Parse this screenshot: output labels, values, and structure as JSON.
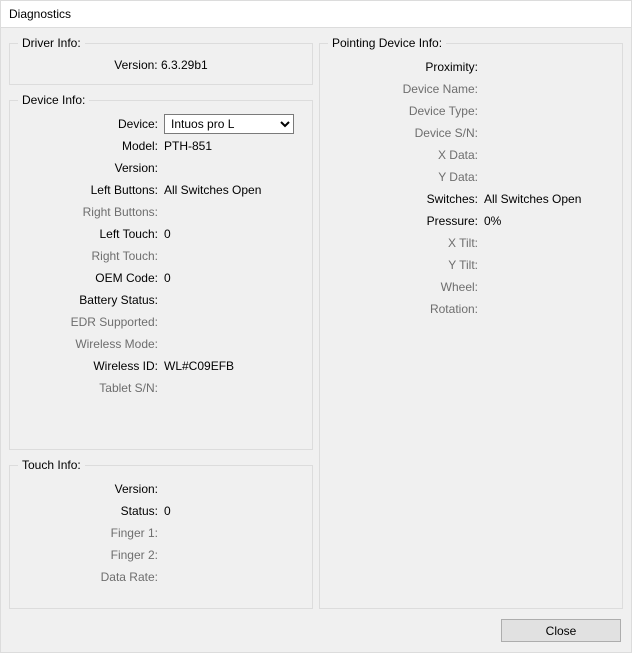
{
  "window_title": "Diagnostics",
  "close_button": "Close",
  "driver": {
    "legend": "Driver Info:",
    "version_label": "Version:",
    "version_value": "6.3.29b1"
  },
  "device": {
    "legend": "Device Info:",
    "device_label": "Device:",
    "device_value": "Intuos pro L",
    "model_label": "Model:",
    "model_value": "PTH-851",
    "version_label": "Version:",
    "version_value": "",
    "left_buttons_label": "Left Buttons:",
    "left_buttons_value": "All Switches Open",
    "right_buttons_label": "Right Buttons:",
    "right_buttons_value": "",
    "left_touch_label": "Left Touch:",
    "left_touch_value": "0",
    "right_touch_label": "Right Touch:",
    "right_touch_value": "",
    "oem_code_label": "OEM Code:",
    "oem_code_value": "0",
    "battery_status_label": "Battery Status:",
    "battery_status_value": "",
    "edr_supported_label": "EDR Supported:",
    "edr_supported_value": "",
    "wireless_mode_label": "Wireless Mode:",
    "wireless_mode_value": "",
    "wireless_id_label": "Wireless ID:",
    "wireless_id_value": "WL#C09EFB",
    "tablet_sn_label": "Tablet S/N:",
    "tablet_sn_value": ""
  },
  "touch": {
    "legend": "Touch Info:",
    "version_label": "Version:",
    "version_value": "",
    "status_label": "Status:",
    "status_value": "0",
    "finger1_label": "Finger 1:",
    "finger1_value": "",
    "finger2_label": "Finger 2:",
    "finger2_value": "",
    "data_rate_label": "Data Rate:",
    "data_rate_value": ""
  },
  "pointing": {
    "legend": "Pointing Device Info:",
    "proximity_label": "Proximity:",
    "proximity_value": "",
    "device_name_label": "Device Name:",
    "device_name_value": "",
    "device_type_label": "Device Type:",
    "device_type_value": "",
    "device_sn_label": "Device S/N:",
    "device_sn_value": "",
    "x_data_label": "X Data:",
    "x_data_value": "",
    "y_data_label": "Y Data:",
    "y_data_value": "",
    "switches_label": "Switches:",
    "switches_value": "All Switches Open",
    "pressure_label": "Pressure:",
    "pressure_value": "0%",
    "x_tilt_label": "X Tilt:",
    "x_tilt_value": "",
    "y_tilt_label": "Y Tilt:",
    "y_tilt_value": "",
    "wheel_label": "Wheel:",
    "wheel_value": "",
    "rotation_label": "Rotation:",
    "rotation_value": ""
  }
}
